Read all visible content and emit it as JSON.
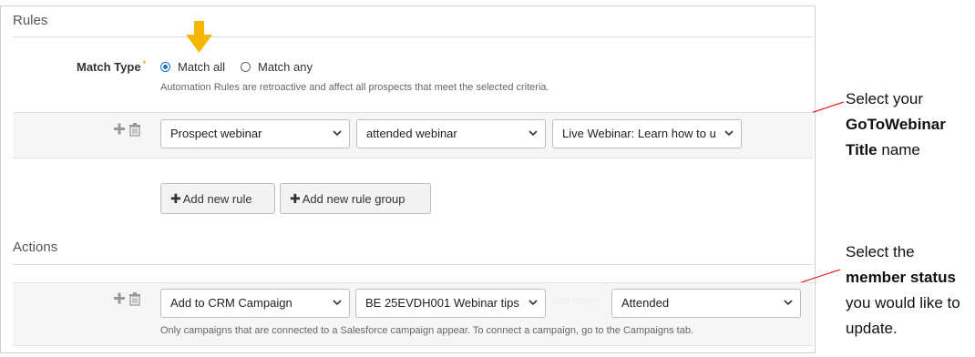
{
  "rules": {
    "title": "Rules",
    "match_type_label": "Match Type",
    "required_mark": "*",
    "match_all": "Match all",
    "match_any": "Match any",
    "match_hint": "Automation Rules are retroactive and affect all prospects that meet the selected criteria.",
    "rule_row": {
      "field": "Prospect webinar",
      "operator": "attended webinar",
      "value": "Live Webinar: Learn how to u"
    },
    "add_rule_label": "Add new rule",
    "add_group_label": "Add new rule group"
  },
  "actions": {
    "title": "Actions",
    "action_row": {
      "action": "Add to CRM Campaign",
      "campaign": "BE 25EVDH001 Webinar tips",
      "status": "Attended",
      "faint_label": "with status"
    },
    "action_hint": "Only campaigns that are connected to a Salesforce campaign appear. To connect a campaign, go to the Campaigns tab."
  },
  "annotations": {
    "note1": {
      "line1": "Select your",
      "bold1": "GoToWebinar",
      "bold2": "Title",
      "rest2": " name"
    },
    "note2": {
      "line1": "Select the",
      "bold1": "member status",
      "line3": "you would like to",
      "line4": "update."
    }
  },
  "icons": {
    "plus": "plus-icon",
    "trash": "trash-icon",
    "chevron": "chevron-down-icon",
    "arrow": "down-arrow-icon"
  },
  "colors": {
    "arrow_yellow": "#f5b800",
    "annotation_red": "#e00000",
    "radio_blue": "#1a73c8"
  }
}
